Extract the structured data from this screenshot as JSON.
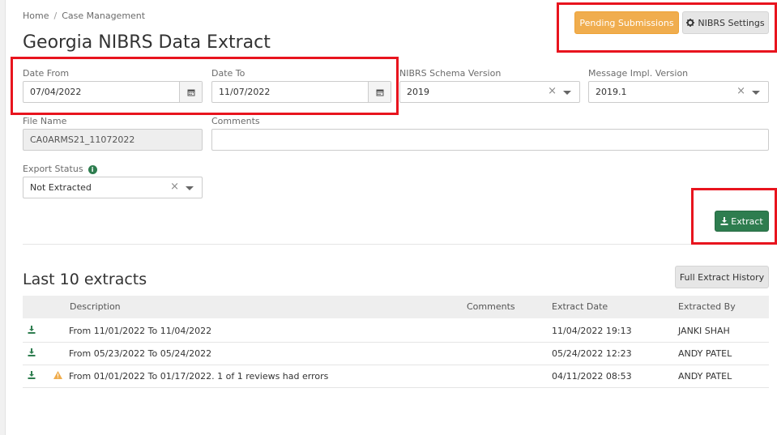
{
  "breadcrumb": {
    "home": "Home",
    "sep": "/",
    "current": "Case Management"
  },
  "page": {
    "title": "Georgia NIBRS Data Extract"
  },
  "header_buttons": {
    "pending": "Pending Submissions",
    "settings": "NIBRS Settings"
  },
  "form": {
    "date_from": {
      "label": "Date From",
      "value": "07/04/2022"
    },
    "date_to": {
      "label": "Date To",
      "value": "11/07/2022"
    },
    "schema_version": {
      "label": "NIBRS Schema Version",
      "value": "2019",
      "clear": "×"
    },
    "message_version": {
      "label": "Message Impl. Version",
      "value": "2019.1",
      "clear": "×"
    },
    "file_name": {
      "label": "File Name",
      "value": "CA0ARMS21_11072022"
    },
    "comments": {
      "label": "Comments",
      "value": ""
    },
    "export_status": {
      "label": "Export Status",
      "value": "Not Extracted",
      "clear": "×",
      "info": "i"
    },
    "extract_button": "Extract"
  },
  "extracts": {
    "title": "Last 10 extracts",
    "history_button": "Full Extract History",
    "columns": {
      "description": "Description",
      "comments": "Comments",
      "extract_date": "Extract Date",
      "extracted_by": "Extracted By"
    },
    "rows": [
      {
        "description": "From 11/01/2022 To 11/04/2022",
        "comments": "",
        "extract_date": "11/04/2022 19:13",
        "extracted_by": "JANKI SHAH",
        "warning": false
      },
      {
        "description": "From 05/23/2022 To 05/24/2022",
        "comments": "",
        "extract_date": "05/24/2022 12:23",
        "extracted_by": "ANDY PATEL",
        "warning": false
      },
      {
        "description": "From 01/01/2022 To 01/17/2022. 1 of 1 reviews had errors",
        "comments": "",
        "extract_date": "04/11/2022 08:53",
        "extracted_by": "ANDY PATEL",
        "warning": true
      }
    ]
  },
  "colors": {
    "accent_green": "#2e7d4f",
    "warning_orange": "#f0ad4e",
    "highlight_red": "#e8141e"
  }
}
